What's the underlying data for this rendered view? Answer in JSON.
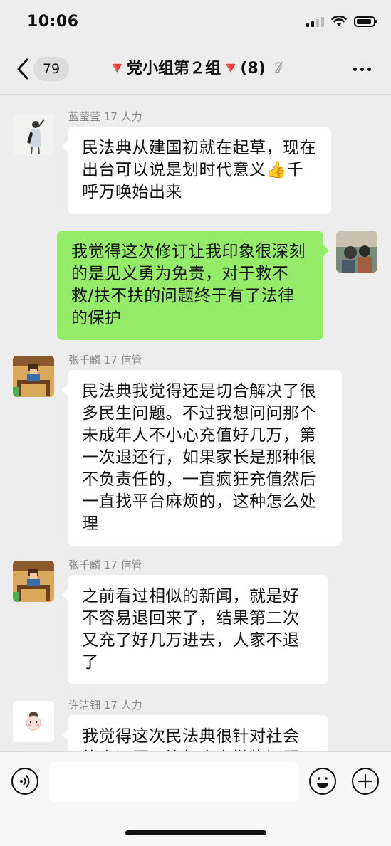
{
  "status": {
    "time": "10:06"
  },
  "nav": {
    "unread": "79",
    "title": "🔻党小组第２组🔻(8)"
  },
  "messages": [
    {
      "sender": "蓝莹莹 17 人力",
      "text": "民法典从建国初就在起草，现在出台可以说是划时代意义👍千呼万唤始出来"
    },
    {
      "text": "我觉得这次修订让我印象很深刻的是见义勇为免责，对于救不救/扶不扶的问题终于有了法律的保护"
    },
    {
      "sender": "张千麟 17 信管",
      "text": "民法典我觉得还是切合解决了很多民生问题。不过我想问问那个未成年人不小心充值好几万，第一次退还行，如果家长是那种很不负责任的，一直疯狂充值然后一直找平台麻烦的，这种怎么处理"
    },
    {
      "sender": "张千麟 17 信管",
      "text": "之前看过相似的新闻，就是好不容易退回来了，结果第二次又充了好几万进去，人家不退了"
    },
    {
      "sender": "许洁钿 17 人力",
      "text": "我觉得这次民法典很针对社会热点问题，比如高空抛物问题"
    }
  ],
  "input": {
    "placeholder": ""
  },
  "colors": {
    "outgoing": "#95ec69",
    "incoming": "#ffffff",
    "background": "#ededed"
  }
}
